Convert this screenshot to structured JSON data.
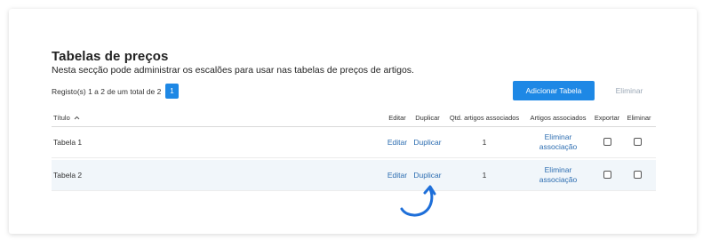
{
  "header": {
    "title": "Tabelas de preços",
    "subtitle": "Nesta secção pode administrar os escalões para usar nas tabelas de preços de artigos."
  },
  "pagination": {
    "records_text": "Registo(s) 1 a 2 de um total de 2",
    "current_page": "1"
  },
  "toolbar": {
    "add_label": "Adicionar Tabela",
    "delete_label": "Eliminar"
  },
  "table": {
    "columns": {
      "title": "Título",
      "edit": "Editar",
      "duplicate": "Duplicar",
      "qty": "Qtd. artigos associados",
      "assoc": "Artigos associados",
      "export": "Exportar",
      "delete": "Eliminar"
    },
    "sort_indicator": "^",
    "rows": [
      {
        "title": "Tabela 1",
        "edit": "Editar",
        "duplicate": "Duplicar",
        "qty": "1",
        "assoc_line1": "Eliminar",
        "assoc_line2": "associação"
      },
      {
        "title": "Tabela 2",
        "edit": "Editar",
        "duplicate": "Duplicar",
        "qty": "1",
        "assoc_line1": "Eliminar",
        "assoc_line2": "associação"
      }
    ]
  },
  "colors": {
    "primary": "#1e88e5",
    "link": "#2b6cb0",
    "row_highlight": "#f1f6fa",
    "annotation_arrow": "#1e6fd9"
  },
  "icons": {
    "sort": "chevron-up-icon",
    "annotation": "curved-arrow-icon"
  }
}
